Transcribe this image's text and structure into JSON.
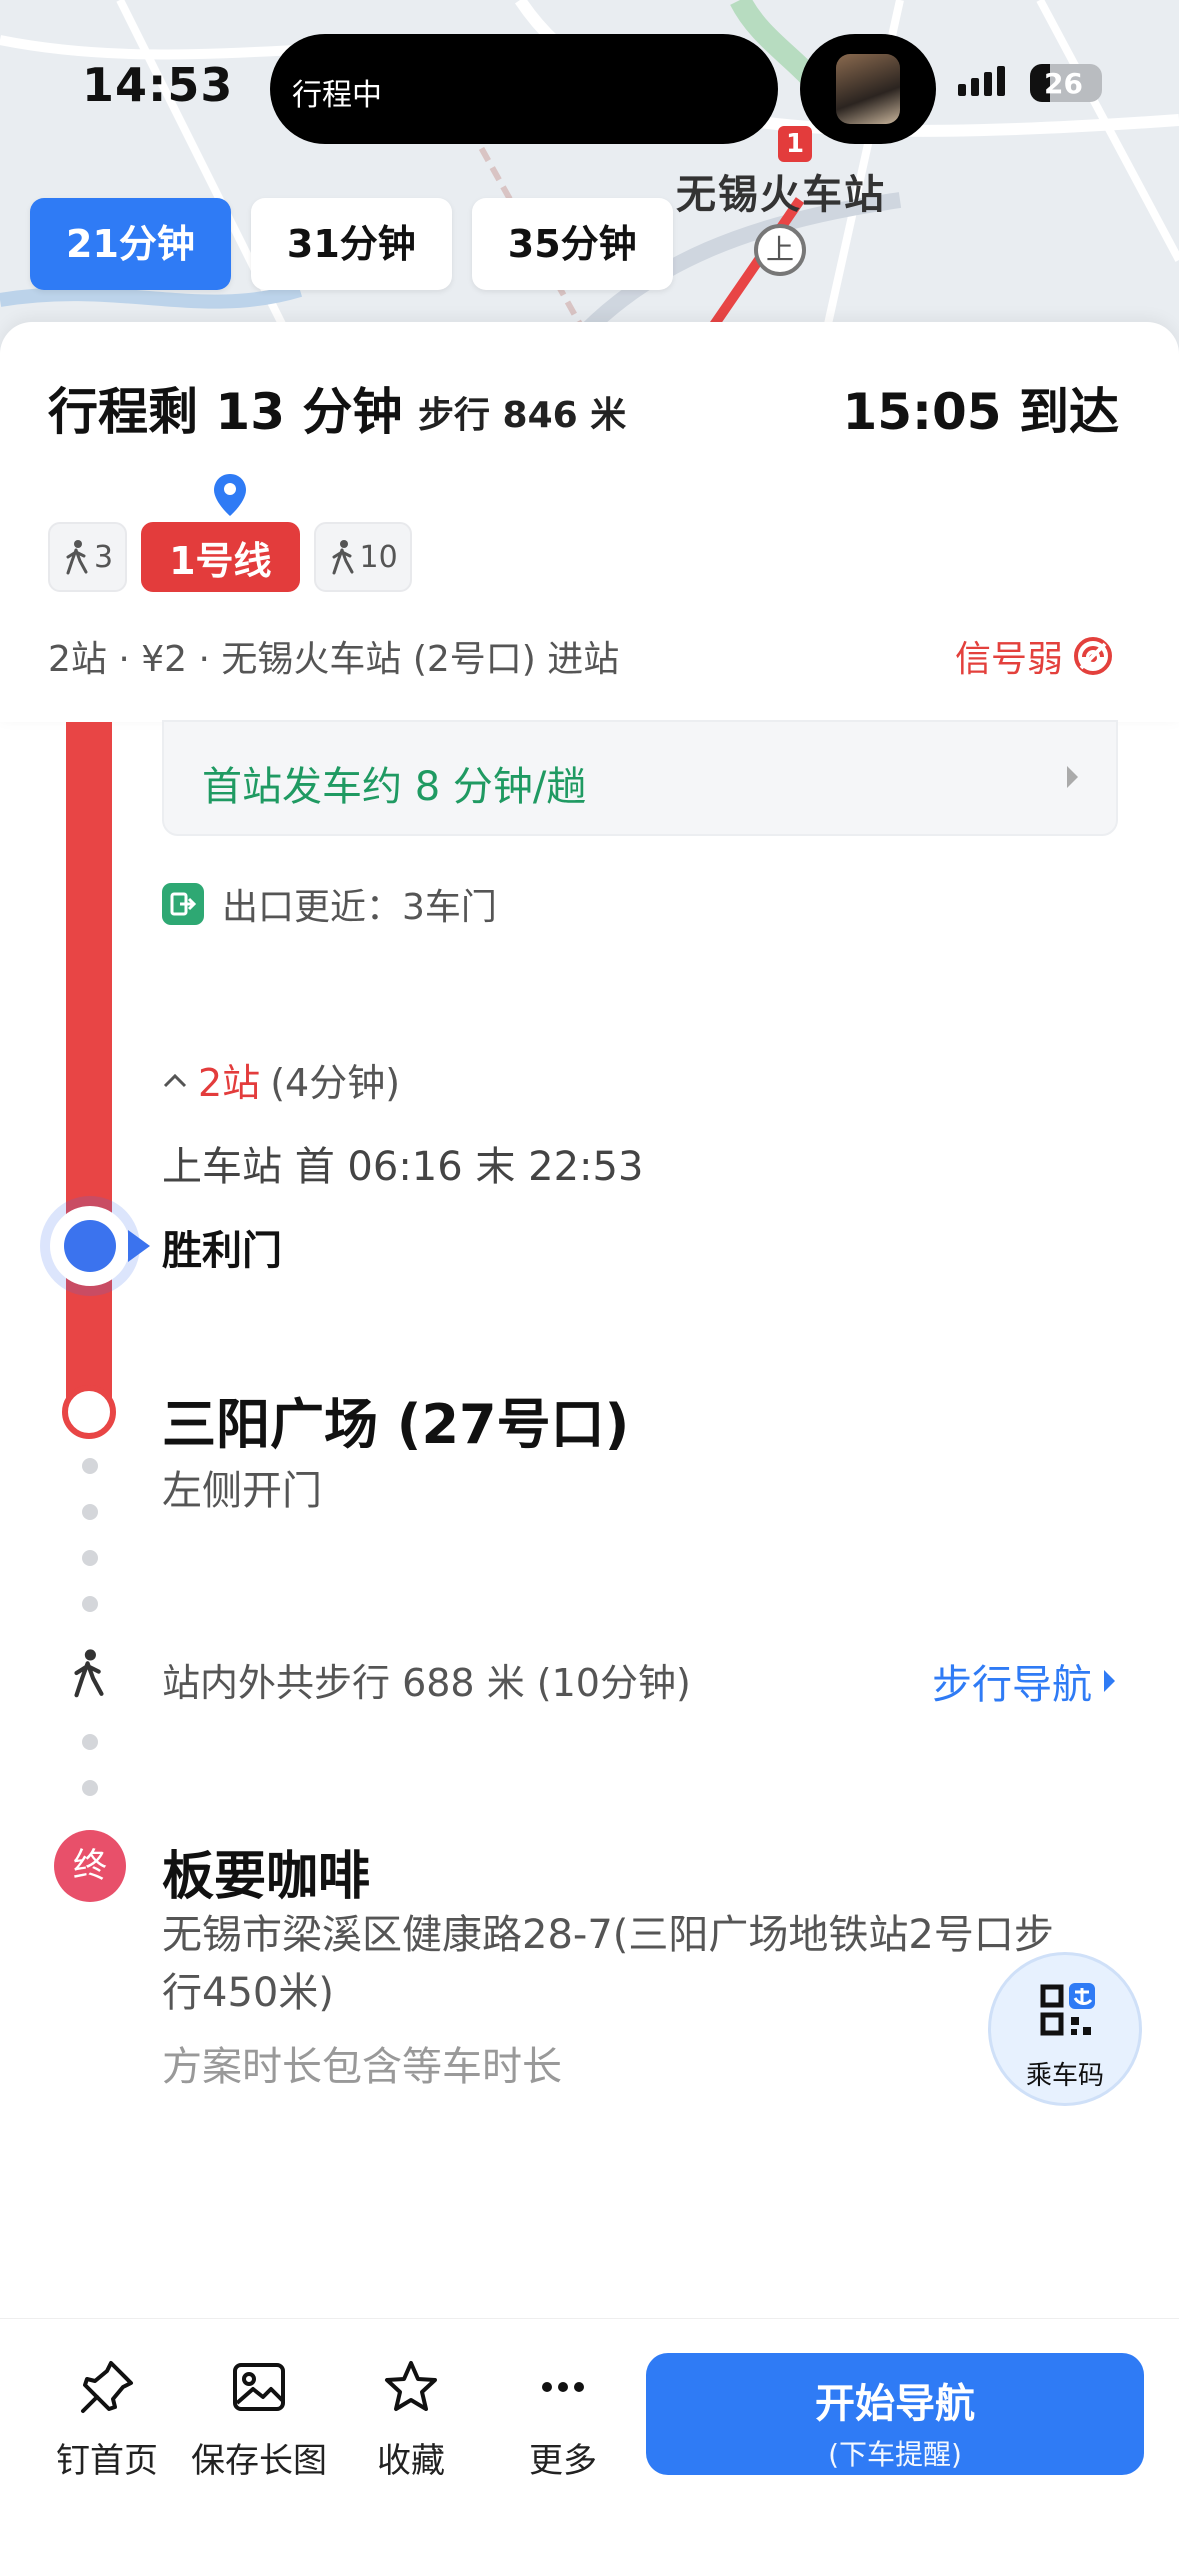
{
  "status_bar": {
    "time": "14:53",
    "island_text": "行程中",
    "battery": "26"
  },
  "map": {
    "station_label": "无锡火车站",
    "metro_badge": "1",
    "exit_label": "上"
  },
  "route_tabs": [
    {
      "label": "21分钟",
      "active": true
    },
    {
      "label": "31分钟",
      "active": false
    },
    {
      "label": "35分钟",
      "active": false
    }
  ],
  "summary": {
    "remaining": "行程剩 13 分钟",
    "walk": "步行 846 米",
    "arrive": "15:05 到达",
    "segments": {
      "walk1": "3",
      "line": "1号线",
      "walk2": "10"
    },
    "info": "2站 · ¥2 · 无锡火车站 (2号口) 进站",
    "signal": "信号弱"
  },
  "timeline": {
    "frequency": "首站发车约 8 分钟/趟",
    "exit_tip": "出口更近：3车门",
    "stops_count": "2站",
    "stops_duration": "(4分钟)",
    "board_times": "上车站 首 06:16  末 22:53",
    "board_station": "胜利门",
    "alight_station": "三阳广场 (27号口)",
    "alight_door": "左侧开门",
    "walk_text": "站内外共步行 688 米 (10分钟)",
    "walk_nav": "步行导航",
    "dest_badge": "终",
    "dest_name": "板要咖啡",
    "dest_address": "无锡市梁溪区健康路28-7(三阳广场地铁站2号口步行450米)",
    "dest_note": "方案时长包含等车时长"
  },
  "ride_code": {
    "label": "乘车码"
  },
  "bottom_bar": {
    "pin": "钉首页",
    "save": "保存长图",
    "favorite": "收藏",
    "more": "更多",
    "start": "开始导航",
    "start_sub": "(下车提醒)"
  },
  "colors": {
    "accent": "#2f7bf5",
    "line1": "#e33c3c",
    "green": "#1f9a62"
  }
}
